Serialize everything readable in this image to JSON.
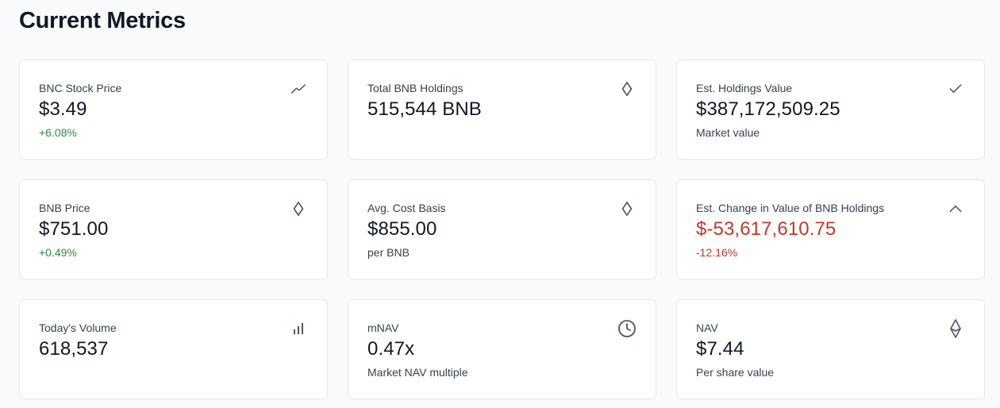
{
  "header": {
    "title": "Current Metrics"
  },
  "cards": [
    {
      "label": "BNC Stock Price",
      "value": "$3.49",
      "sub": "+6.08%",
      "icon": "trend-up-icon"
    },
    {
      "label": "Total BNB Holdings",
      "value": "515,544 BNB",
      "sub": "",
      "icon": "diamond-icon"
    },
    {
      "label": "Est. Holdings Value",
      "value": "$387,172,509.25",
      "sub": "Market value",
      "icon": "check-icon"
    },
    {
      "label": "BNB Price",
      "value": "$751.00",
      "sub": "+0.49%",
      "icon": "diamond-icon"
    },
    {
      "label": "Avg. Cost Basis",
      "value": "$855.00",
      "sub": "per BNB",
      "icon": "diamond-icon"
    },
    {
      "label": "Est. Change in Value of BNB Holdings",
      "value": "$-53,617,610.75",
      "sub": "-12.16%",
      "icon": "chevron-up-icon"
    },
    {
      "label": "Today's Volume",
      "value": "618,537",
      "sub": "",
      "icon": "bar-chart-icon"
    },
    {
      "label": "mNAV",
      "value": "0.47x",
      "sub": "Market NAV multiple",
      "icon": "clock-icon"
    },
    {
      "label": "NAV",
      "value": "$7.44",
      "sub": "Per share value",
      "icon": "ethereum-icon"
    }
  ],
  "colors": {
    "positive": "#2e8b3e",
    "negative": "#c0392b",
    "text": "#111827",
    "muted": "#374151",
    "border": "#e5e7eb"
  }
}
